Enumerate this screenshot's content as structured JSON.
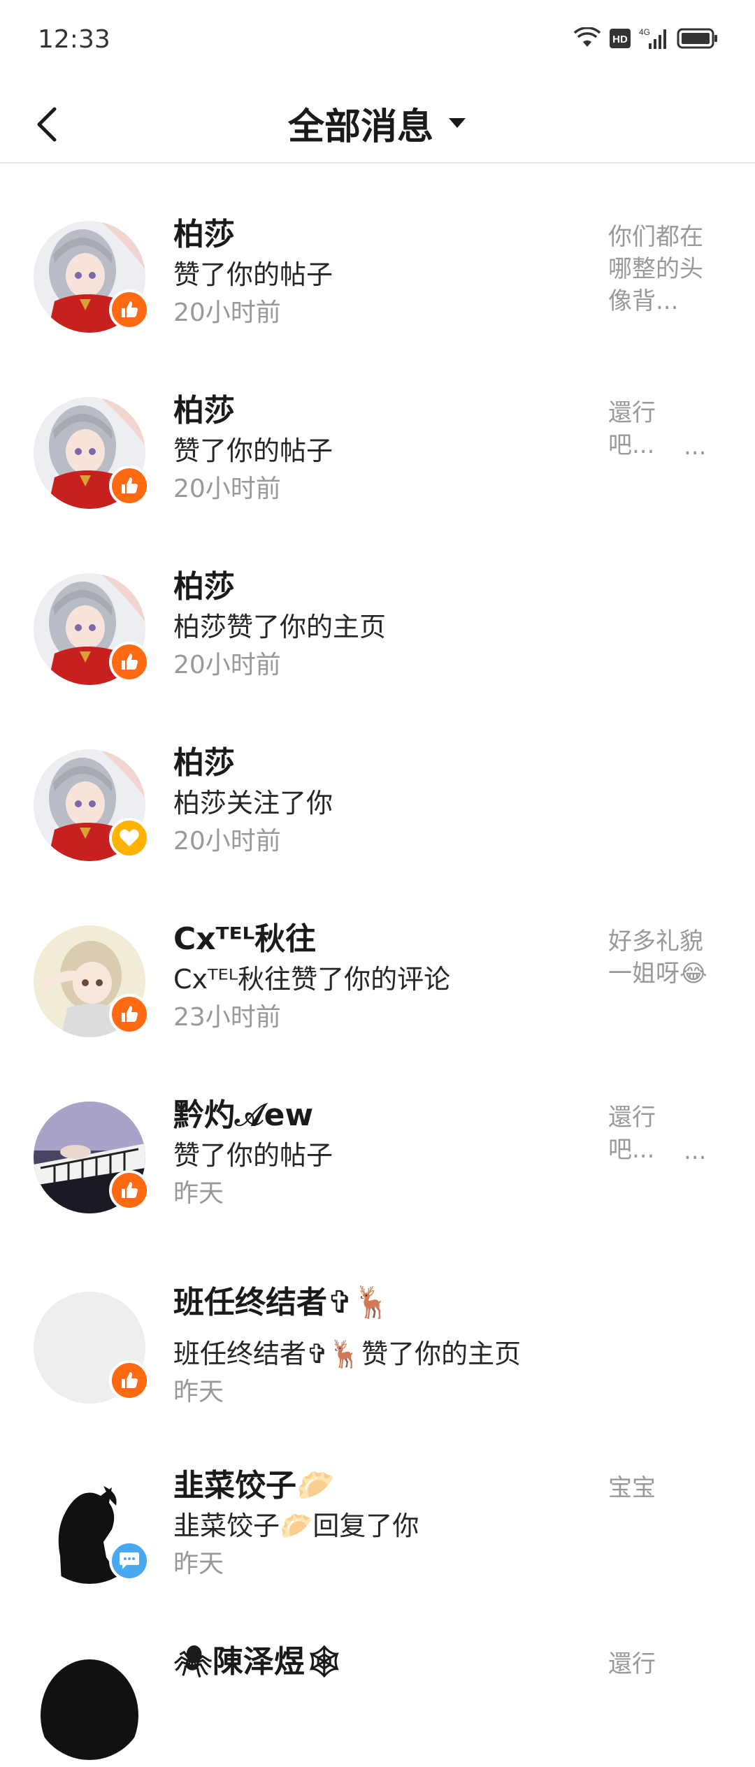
{
  "status_bar": {
    "time": "12:33",
    "hd_label": "HD",
    "net_label": "4G"
  },
  "header": {
    "title": "全部消息"
  },
  "messages": [
    {
      "name": "柏莎",
      "action": "赞了你的帖子",
      "time": "20小时前",
      "preview": [
        "你们都在",
        "哪整的头",
        "像背..."
      ],
      "badge": "like",
      "avatar": "silver-hair-girl"
    },
    {
      "name": "柏莎",
      "action": "赞了你的帖子",
      "time": "20小时前",
      "preview": [
        "還行",
        "吧..."
      ],
      "preview_more": "...",
      "badge": "like",
      "avatar": "silver-hair-girl"
    },
    {
      "name": "柏莎",
      "action": "柏莎赞了你的主页",
      "time": "20小时前",
      "preview": [],
      "badge": "like",
      "avatar": "silver-hair-girl"
    },
    {
      "name": "柏莎",
      "action": "柏莎关注了你",
      "time": "20小时前",
      "preview": [],
      "badge": "heart",
      "avatar": "silver-hair-girl"
    },
    {
      "name": "Cxᵀᴱᴸ秋往",
      "action": "Cxᵀᴱᴸ秋往赞了你的评论",
      "time": "23小时前",
      "preview": [
        "好多礼貌",
        "一姐呀😂"
      ],
      "badge": "like",
      "avatar": "blonde-girl"
    },
    {
      "name": "黔灼𝒜ew",
      "action": "赞了你的帖子",
      "time": "昨天",
      "preview": [
        "還行",
        "吧..."
      ],
      "preview_more": "...",
      "badge": "like",
      "avatar": "piano-hands"
    },
    {
      "name": "班任终结者✞🦌",
      "action": "班任终结者✞🦌赞了你的主页",
      "time": "昨天",
      "preview": [],
      "badge": "like",
      "avatar": "blank"
    },
    {
      "name": "韭菜饺子🥟",
      "action": "韭菜饺子🥟回复了你",
      "time": "昨天",
      "preview": [
        "宝宝"
      ],
      "badge": "comment",
      "avatar": "silhouette"
    },
    {
      "name": "🕷陳泽煜🕸",
      "action": "",
      "time": "",
      "preview": [
        "還行"
      ],
      "badge": "",
      "avatar": "dark"
    }
  ],
  "colors": {
    "like_badge": "#ff6a13",
    "follow_badge": "#ffb300",
    "comment_badge": "#4aa8f0",
    "secondary_text": "#999999"
  }
}
